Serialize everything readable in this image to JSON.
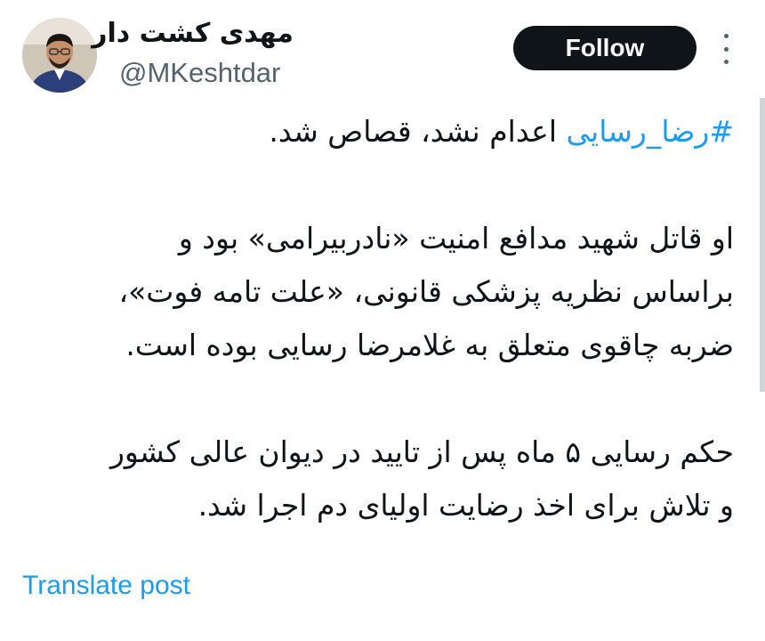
{
  "author": {
    "display_name": "مهدی کشت دار",
    "handle": "@MKeshtdar"
  },
  "actions": {
    "follow_label": "Follow",
    "more_icon": "more-vertical-icon"
  },
  "post": {
    "hashtag": "#رضا_رسایی",
    "lines": [
      " اعدام نشد، قصاص شد.",
      "او قاتل شهید مدافع امنیت «نادربیرامی» بود و",
      "براساس نظریه پزشکی قانونی، «علت تامه فوت»،",
      "ضربه چاقوی متعلق به غلامرضا رسایی بوده است.",
      "حکم رسایی ۵ ماه پس از تایید در دیوان عالی کشور",
      "و تلاش برای اخذ رضایت اولیای دم اجرا شد."
    ]
  },
  "footer": {
    "translate_label": "Translate post"
  },
  "colors": {
    "accent": "#1d9bf0",
    "text": "#0f1419",
    "muted": "#536471",
    "button": "#0f1419"
  }
}
